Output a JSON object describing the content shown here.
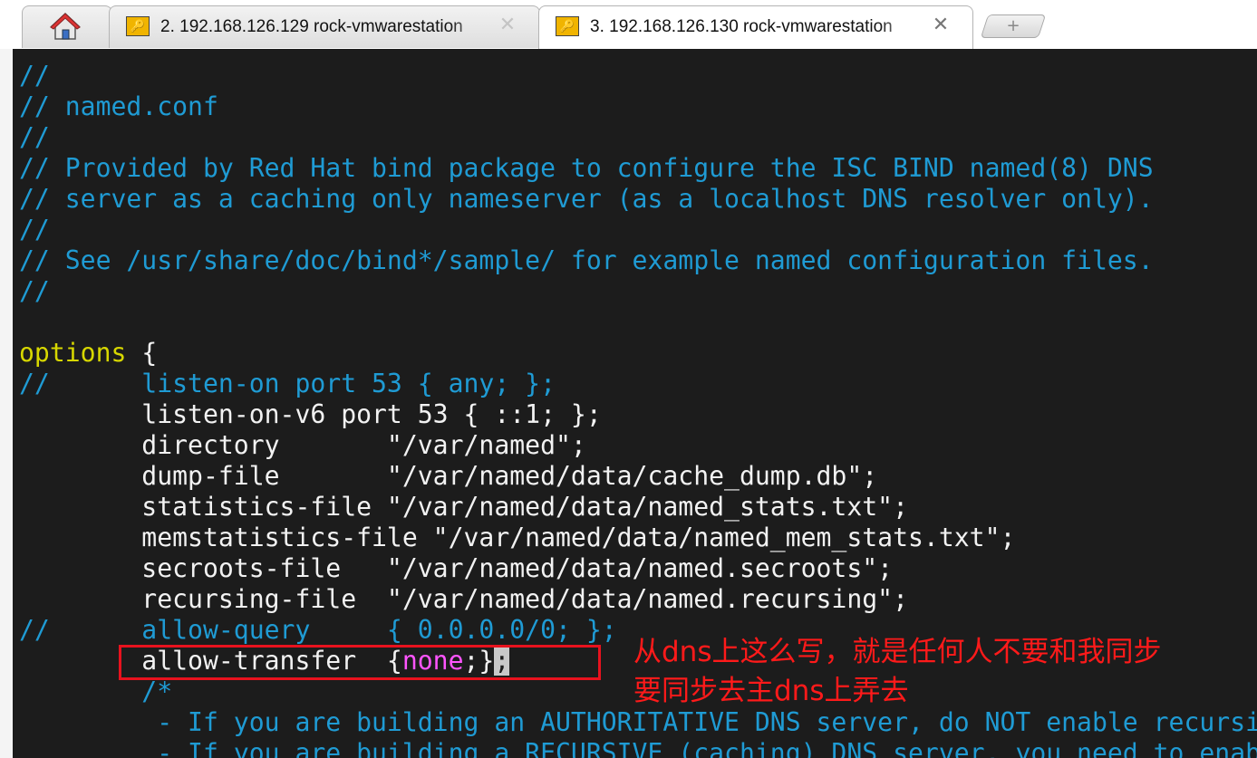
{
  "tabs": [
    {
      "label": "",
      "icon": "home-icon"
    },
    {
      "label": "2. 192.168.126.129 rock-vmwarestation",
      "icon": "key-icon",
      "close": "✕"
    },
    {
      "label": "3. 192.168.126.130 rock-vmwarestation",
      "icon": "key-icon",
      "close": "✕",
      "active": true
    }
  ],
  "new_tab_label": "+",
  "colors": {
    "terminal_bg": "#1c1c1c",
    "comment": "#1f9bd4",
    "keyword": "#d7d700",
    "value_none": "#ff55ff",
    "annotation": "#e8121e"
  },
  "terminal": {
    "lines": [
      "//",
      "// named.conf",
      "//",
      "// Provided by Red Hat bind package to configure the ISC BIND named(8) DNS",
      "// server as a caching only nameserver (as a localhost DNS resolver only).",
      "//",
      "// See /usr/share/doc/bind*/sample/ for example named configuration files.",
      "//",
      "",
      "options {",
      "//      listen-on port 53 { any; };",
      "        listen-on-v6 port 53 { ::1; };",
      "        directory       \"/var/named\";",
      "        dump-file       \"/var/named/data/cache_dump.db\";",
      "        statistics-file \"/var/named/data/named_stats.txt\";",
      "        memstatistics-file \"/var/named/data/named_mem_stats.txt\";",
      "        secroots-file   \"/var/named/data/named.secroots\";",
      "        recursing-file  \"/var/named/data/named.recursing\";",
      "//      allow-query     { 0.0.0.0/0; };",
      "        allow-transfer  {none;};",
      "        /*",
      "         - If you are building an AUTHORITATIVE DNS server, do NOT enable recursion.",
      "         - If you are building a RECURSIVE (caching) DNS server, you need to enable"
    ],
    "options_keyword": "options",
    "allow_transfer_prefix": "        allow-transfer  {",
    "allow_transfer_value": "none",
    "allow_transfer_suffix": ";}",
    "cursor_char": ";"
  },
  "annotation": {
    "line1": "从dns上这么写，就是任何人不要和我同步",
    "line2": "要同步去主dns上弄去"
  }
}
